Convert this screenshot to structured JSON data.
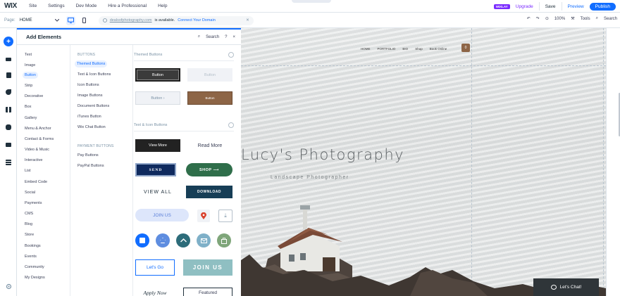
{
  "app": {
    "logo": "WIX",
    "menu": [
      "Site",
      "Settings",
      "Dev Mode",
      "Hire a Professional",
      "Help"
    ],
    "badge": "WIXLAY",
    "upgrade": "Upgrade",
    "save": "Save",
    "preview": "Preview",
    "publish": "Publish"
  },
  "toolbar": {
    "page_label": "Page:",
    "page_value": "HOME",
    "url_domain": "dealsofphotography.com",
    "url_available": "is available.",
    "url_link": "Connect Your Domain",
    "zoom": "100%",
    "tools": "Tools",
    "search": "Search"
  },
  "panel": {
    "title": "Add Elements",
    "search": "Search",
    "help": "?",
    "close": "×",
    "categories": [
      "Text",
      "Image",
      "Button",
      "Strip",
      "Decorative",
      "Box",
      "Gallery",
      "Menu & Anchor",
      "Contact & Forms",
      "Video & Music",
      "Interactive",
      "List",
      "Embed Code",
      "Social",
      "Payments",
      "CMS",
      "Blog",
      "Store",
      "Bookings",
      "Events",
      "Community",
      "My Designs"
    ],
    "active_category": "Button",
    "buttons_heading": "BUTTONS",
    "button_types": [
      "Themed Buttons",
      "Text & Icon Buttons",
      "Icon Buttons",
      "Image Buttons",
      "Document Buttons",
      "iTunes Button",
      "Wix Chat Button"
    ],
    "payment_heading": "PAYMENT BUTTONS",
    "payment_types": [
      "Pay Buttons",
      "PayPal Buttons"
    ],
    "section1_title": "Themed Buttons",
    "section2_title": "Text & Icon Buttons",
    "previews": {
      "b1": "Button",
      "b2": "Button",
      "b3": "Button",
      "b4": "Button",
      "b5": "View More",
      "b6": "Read More",
      "b7": "SEND",
      "b8": "SHOP",
      "b9": "VIEW ALL",
      "b10": "DOWNLOAD",
      "b11": "JOIN US",
      "b14": "Let's Go",
      "b15": "JOIN US",
      "b16": "Apply Now",
      "b17": "Featured"
    }
  },
  "site": {
    "nav": [
      "HOME",
      "PORTFOLIO",
      "BIO",
      "Shop",
      "Book Online"
    ],
    "cart_count": "0",
    "title": "Lucy's Photography",
    "subtitle": "Landscape Photographer",
    "chat_label": "Let's Chat!"
  },
  "colors": {
    "accent": "#116dff",
    "upgrade": "#7a2bff",
    "brown": "#8d6546"
  }
}
